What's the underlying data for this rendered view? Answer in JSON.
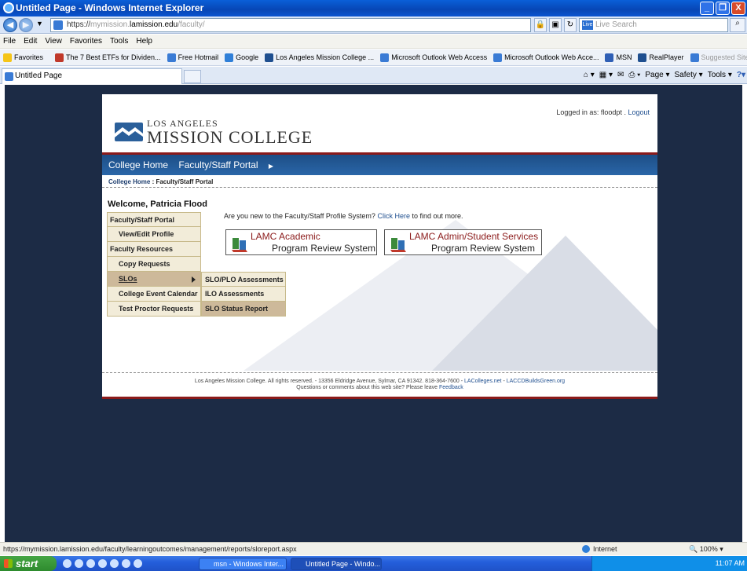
{
  "window": {
    "title": "Untitled Page - Windows Internet Explorer",
    "buttons": [
      "_",
      "❐",
      "X"
    ]
  },
  "address": {
    "scheme": "https://",
    "host_prefix": "mymission.",
    "host": "lamission.edu",
    "path": "/faculty/",
    "search_placeholder": "Live Search"
  },
  "menu": [
    "File",
    "Edit",
    "View",
    "Favorites",
    "Tools",
    "Help"
  ],
  "favorites": {
    "label": "Favorites",
    "items": [
      {
        "label": "The 7 Best ETFs for Dividen...",
        "color": "#c0392b"
      },
      {
        "label": "Free Hotmail",
        "color": "#3a7bd5"
      },
      {
        "label": "Google",
        "color": "#2f7fd8"
      },
      {
        "label": "Los Angeles Mission College ...",
        "color": "#1f4f8f"
      },
      {
        "label": "Microsoft Outlook Web Access",
        "color": "#3a7bd5"
      },
      {
        "label": "Microsoft Outlook Web Acce...",
        "color": "#3a7bd5"
      },
      {
        "label": "MSN",
        "color": "#2f5fb5"
      },
      {
        "label": "RealPlayer",
        "color": "#1f4f8f"
      },
      {
        "label": "Suggested Sites",
        "color": "#3a7bd5"
      }
    ]
  },
  "tab": {
    "label": "Untitled Page"
  },
  "commands": [
    "Page",
    "Safety",
    "Tools"
  ],
  "site": {
    "college_small": "LOS ANGELES",
    "college_big": "MISSION COLLEGE",
    "logged_prefix": "Logged in as: floodpt .",
    "logout": "Logout",
    "nav": [
      "College Home",
      "Faculty/Staff Portal"
    ],
    "crumb_link": "College Home",
    "crumb_current": ": Faculty/Staff Portal",
    "welcome": "Welcome, Patricia Flood",
    "left_menu": [
      {
        "label": "Faculty/Staff Portal",
        "sub": false,
        "hl": false
      },
      {
        "label": "View/Edit Profile",
        "sub": true,
        "hl": false
      },
      {
        "label": "Faculty Resources",
        "sub": false,
        "hl": false
      },
      {
        "label": "Copy Requests",
        "sub": true,
        "hl": false
      },
      {
        "label": "SLOs",
        "sub": true,
        "hl": true
      },
      {
        "label": "College Event Calendar",
        "sub": true,
        "hl": false
      },
      {
        "label": "Test Proctor Requests",
        "sub": true,
        "hl": false
      }
    ],
    "submenu": [
      {
        "label": "SLO/PLO Assessments",
        "hl": false
      },
      {
        "label": "ILO Assessments",
        "hl": false
      },
      {
        "label": "SLO Status Report",
        "hl": true
      }
    ],
    "new_question": "Are you new to the Faculty/Staff Profile System?",
    "click_here": "Click Here",
    "new_tail": "to find out more.",
    "academic_line1": "LAMC Academic",
    "academic_line2": "Program Review System",
    "admin_line1": "LAMC Admin/Student Services",
    "admin_line2": "Program Review System",
    "footer_text": "Los Angeles Mission College. All rights reserved. - 13356 Eldridge Avenue, Sylmar, CA 91342. 818-364-7600 -",
    "footer_link1": "LAColleges.net",
    "footer_sep": "-",
    "footer_link2": "LACCDBuildsGreen.org",
    "footer_line2": "Questions or comments about this web site? Please leave",
    "footer_feedback": "Feedback"
  },
  "status": {
    "url": "https://mymission.lamission.edu/faculty/learningoutcomes/management/reports/sloreport.aspx",
    "zone": "Internet",
    "zoom": "100%"
  },
  "taskbar": {
    "start": "start",
    "buttons": [
      "msn - Windows Inter...",
      "Untitled Page - Windo..."
    ],
    "time": "11:07 AM"
  },
  "colors": {
    "accent_red": "#8b1a1a",
    "nav_blue": "#1d4e86",
    "menu_bg": "#f2ecd9",
    "menu_highlight": "#cdb99a",
    "background": "#1c2b45"
  }
}
